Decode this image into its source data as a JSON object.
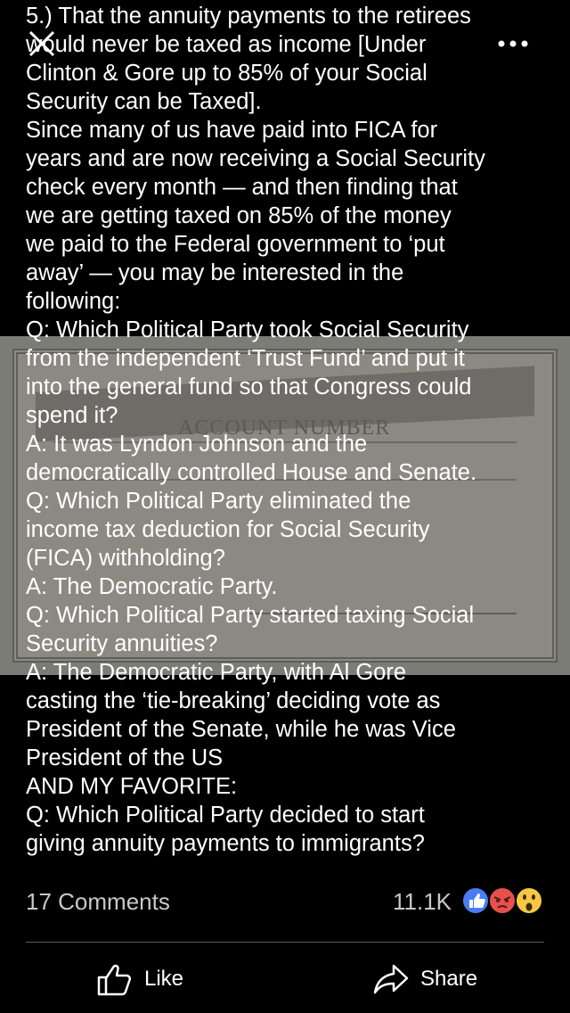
{
  "post": {
    "lines": [
      "5.) That the annuity payments to the retirees",
      "would never be taxed as income [Under",
      "Clinton & Gore up to 85% of your Social",
      "Security can be Taxed].",
      "Since many of us have paid into FICA for",
      "years and are now receiving a Social Security",
      "check every month — and then finding that",
      "we are getting taxed on 85% of the money",
      "we paid to the Federal government to ‘put",
      "away’ — you may be interested in the",
      "following:",
      "Q: Which Political Party took Social Security",
      "from the independent ‘Trust Fund’ and put it",
      "into the general fund so that Congress could",
      "spend it?",
      "A: It was Lyndon Johnson and the",
      "democratically controlled House and Senate.",
      "Q: Which Political Party eliminated the",
      "income tax deduction for Social Security",
      "(FICA) withholding?",
      "A: The Democratic Party.",
      "Q: Which Political Party started taxing Social",
      "Security annuities?",
      "A: The Democratic Party, with Al Gore",
      "casting the ‘tie-breaking’ deciding vote as",
      "President of the Senate, while he was Vice",
      "President of the US",
      "AND MY FAVORITE:",
      "Q: Which Political Party decided to start",
      "giving annuity payments to immigrants?"
    ]
  },
  "background_image": {
    "account_label": "ACCOUNT NUMBER"
  },
  "stats": {
    "comments": "17 Comments",
    "reactions": "11.1K",
    "reaction_icons": [
      "like-icon",
      "angry-icon",
      "wow-icon"
    ]
  },
  "actions": {
    "like_label": "Like",
    "share_label": "Share"
  },
  "colors": {
    "like_blue": "#4a7cf3",
    "angry_red": "#e8504a",
    "wow_yellow": "#f7c744"
  }
}
